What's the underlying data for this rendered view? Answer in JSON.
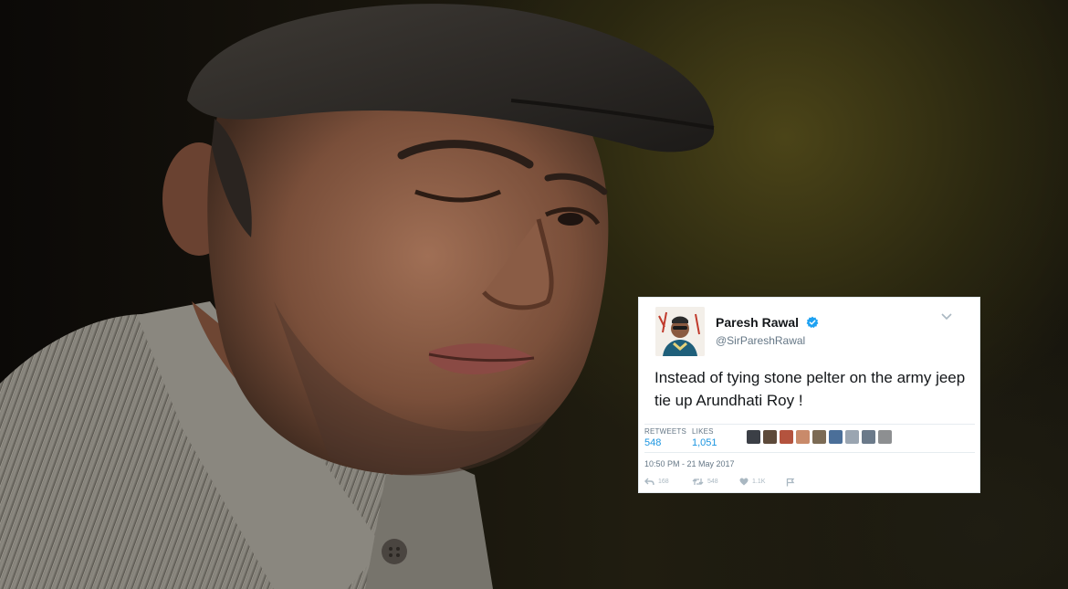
{
  "tweet": {
    "author_name": "Paresh Rawal",
    "handle": "@SirPareshRawal",
    "text": "Instead of tying stone pelter on the army jeep tie up Arundhati Roy !",
    "retweets_label": "RETWEETS",
    "retweets_value": "548",
    "likes_label": "LIKES",
    "likes_value": "1,051",
    "timestamp": "10:50 PM - 21 May 2017",
    "reply_count": "168",
    "retweet_count": "548",
    "like_count": "1.1K"
  },
  "colors": {
    "verified_blue": "#1da1f2",
    "link_blue": "#1b95e0",
    "muted_gray": "#657786"
  }
}
